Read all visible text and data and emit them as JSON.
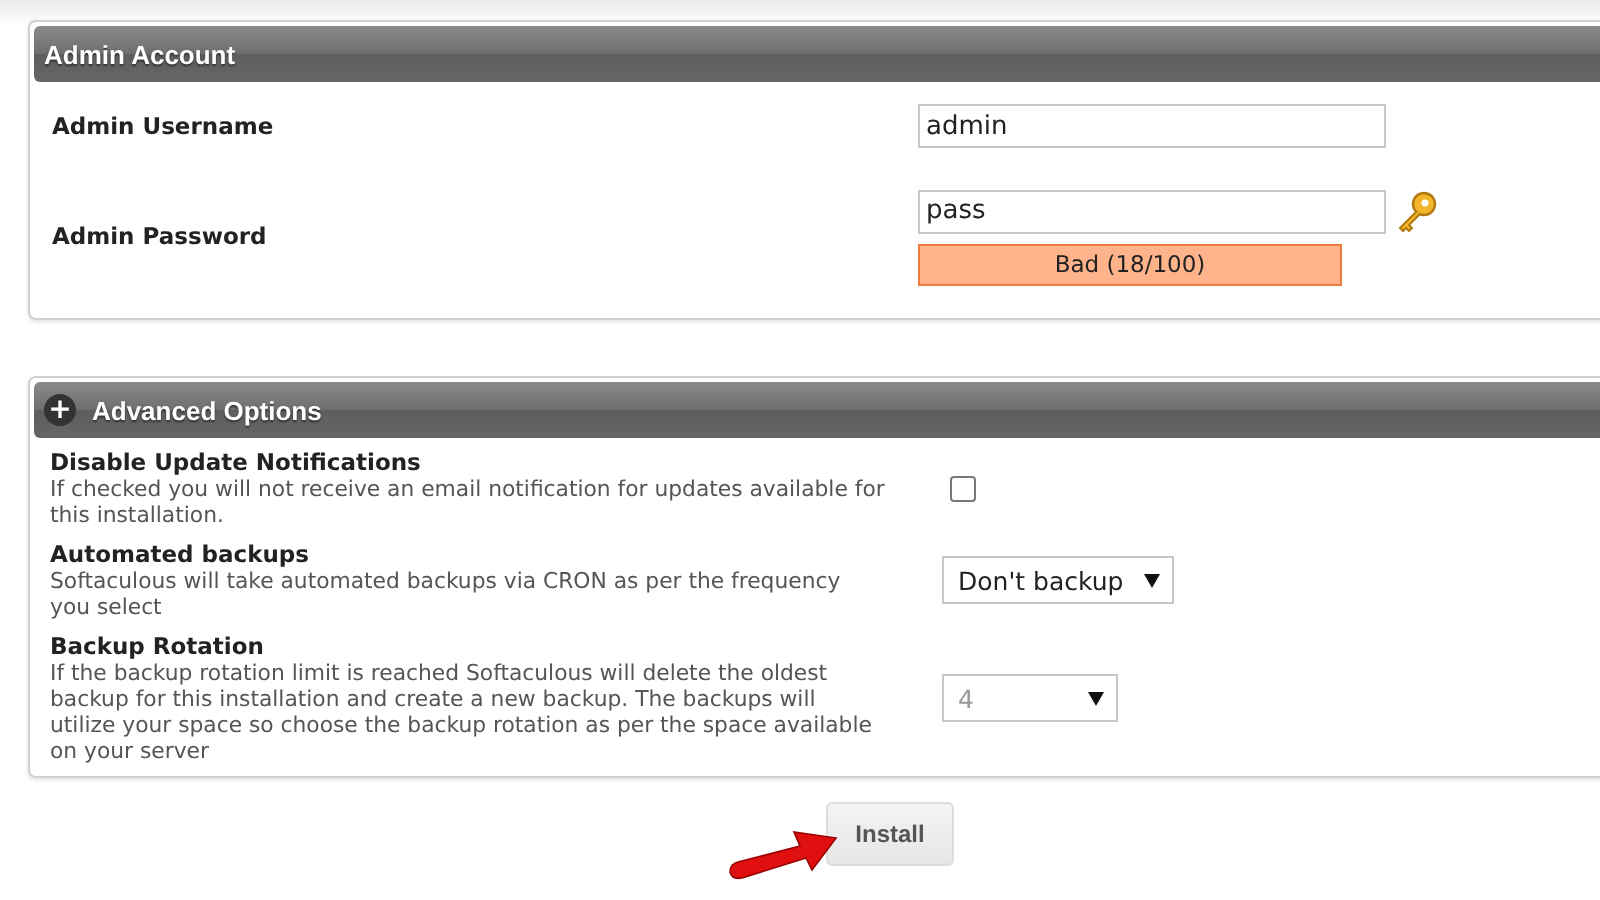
{
  "account_panel": {
    "title": "Admin Account",
    "fields": [
      {
        "label": "Admin Username",
        "value": "admin"
      },
      {
        "label": "Admin Password",
        "value": "pass",
        "strength": "Bad (18/100)"
      }
    ]
  },
  "advanced_panel": {
    "title": "Advanced Options",
    "expand_symbol": "+",
    "options": [
      {
        "kind": "checkbox",
        "label": "Disable Update Notifications",
        "description": "If checked you will not receive an email notification for updates available for this installation.",
        "checked": false
      },
      {
        "kind": "select",
        "label": "Automated backups",
        "description": "Softaculous will take automated backups via CRON as per the frequency you select",
        "value": "Don't backup",
        "disabled": false
      },
      {
        "kind": "select",
        "label": "Backup Rotation",
        "description": "If the backup rotation limit is reached Softaculous will delete the oldest backup for this installation and create a new backup. The backups will utilize your space so choose the backup rotation as per the space available on your server",
        "value": "4",
        "disabled": true
      }
    ]
  },
  "install_button": "Install"
}
